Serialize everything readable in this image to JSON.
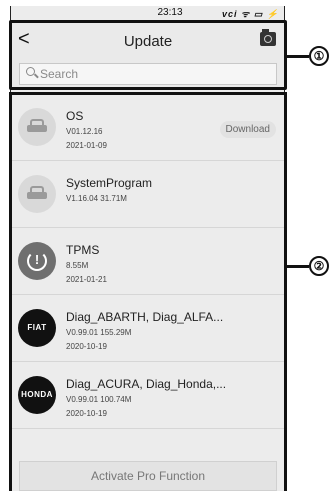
{
  "status_bar": {
    "time": "23:13",
    "icons": "vci ᯤ ▭ ⚡"
  },
  "app_bar": {
    "title": "Update"
  },
  "search": {
    "placeholder": "Search"
  },
  "items": [
    {
      "name": "OS",
      "version": "V01.12.16",
      "date": "2021-01-09",
      "action": "Download",
      "logo": "car-icon"
    },
    {
      "name": "SystemProgram",
      "version": "V1.16.04   31.71M",
      "logo": "car-icon"
    },
    {
      "name": "TPMS",
      "version": "8.55M",
      "date": "2021-01-21",
      "logo": "tpms-icon"
    },
    {
      "name": "Diag_ABARTH, Diag_ALFA...",
      "version": "V0.99.01   155.29M",
      "date": "2020-10-19",
      "logo": "fiat-logo",
      "logo_text": "FIAT"
    },
    {
      "name": "Diag_ACURA, Diag_Honda,...",
      "version": "V0.99.01   100.74M",
      "date": "2020-10-19",
      "logo": "honda-logo",
      "logo_text": "HONDA"
    }
  ],
  "footer": {
    "activate_label": "Activate Pro Function"
  },
  "callouts": [
    "①",
    "②"
  ]
}
